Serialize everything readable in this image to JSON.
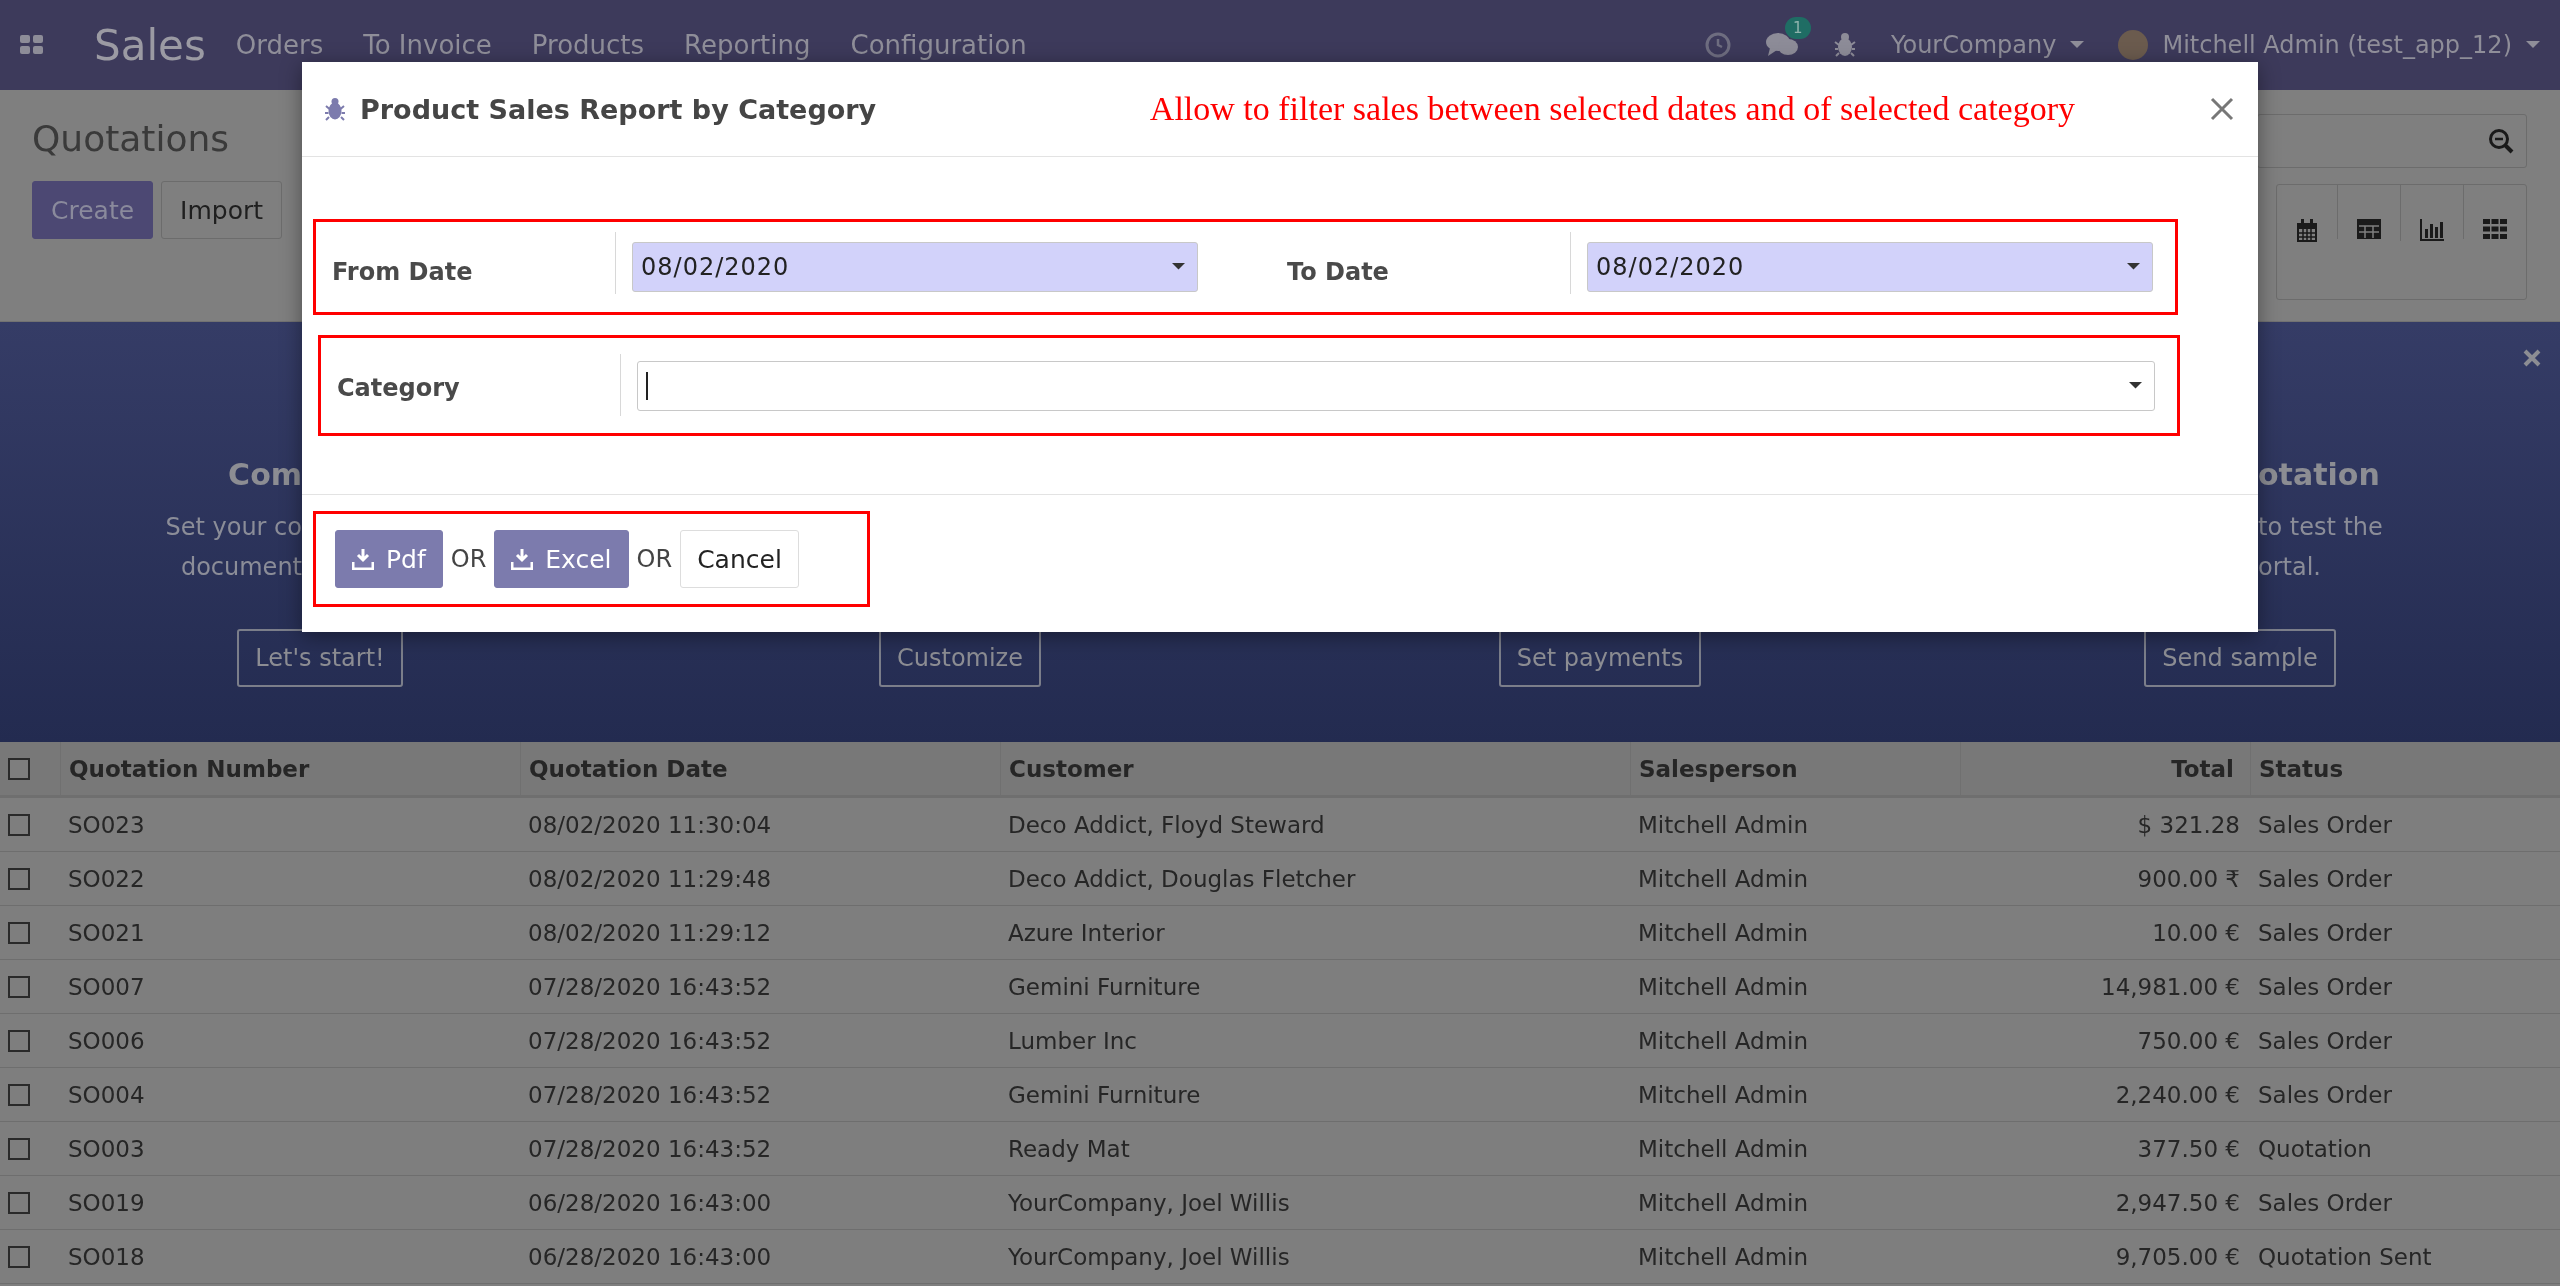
{
  "navbar": {
    "app_title": "Sales",
    "menu": [
      "Orders",
      "To Invoice",
      "Products",
      "Reporting",
      "Configuration"
    ],
    "message_count": "1",
    "company": "YourCompany",
    "user": "Mitchell Admin (test_app_12)"
  },
  "control_panel": {
    "title": "Quotations",
    "buttons": [
      {
        "label": "Create",
        "kind": "primary"
      },
      {
        "label": "Import",
        "kind": "secondary"
      }
    ]
  },
  "banner": {
    "left": {
      "heading": "Com",
      "lines": [
        "Set your co",
        "document"
      ]
    },
    "right": {
      "heading": "otation",
      "lines": [
        "to test the",
        "ortal."
      ]
    },
    "buttons": [
      "Let's start!",
      "Customize",
      "Set payments",
      "Send sample"
    ]
  },
  "dialog": {
    "title": "Product Sales Report by Category",
    "annotation": "Allow to filter sales between selected dates and of selected category",
    "date_fields": [
      {
        "label": "From Date",
        "value": "08/02/2020",
        "required": true
      },
      {
        "label": "To Date",
        "value": "08/02/2020",
        "required": true
      }
    ],
    "category_field": {
      "label": "Category",
      "required": false
    },
    "footer": [
      {
        "kind": "primary",
        "label": "Pdf"
      },
      {
        "kind": "text",
        "label": "OR"
      },
      {
        "kind": "primary",
        "label": "Excel"
      },
      {
        "kind": "text",
        "label": "OR"
      },
      {
        "kind": "secondary",
        "label": "Cancel"
      }
    ]
  },
  "table": {
    "all_checked": false,
    "columns": [
      "Quotation Number",
      "Quotation Date",
      "Customer",
      "Salesperson",
      "Total",
      "Status"
    ],
    "rows": [
      {
        "checked": false,
        "cells": [
          "SO023",
          "08/02/2020 11:30:04",
          "Deco Addict, Floyd Steward",
          "Mitchell Admin",
          "$ 321.28",
          "Sales Order"
        ]
      },
      {
        "checked": false,
        "cells": [
          "SO022",
          "08/02/2020 11:29:48",
          "Deco Addict, Douglas Fletcher",
          "Mitchell Admin",
          "900.00 ₹",
          "Sales Order"
        ]
      },
      {
        "checked": false,
        "cells": [
          "SO021",
          "08/02/2020 11:29:12",
          "Azure Interior",
          "Mitchell Admin",
          "10.00 €",
          "Sales Order"
        ]
      },
      {
        "checked": false,
        "cells": [
          "SO007",
          "07/28/2020 16:43:52",
          "Gemini Furniture",
          "Mitchell Admin",
          "14,981.00 €",
          "Sales Order"
        ]
      },
      {
        "checked": false,
        "cells": [
          "SO006",
          "07/28/2020 16:43:52",
          "Lumber Inc",
          "Mitchell Admin",
          "750.00 €",
          "Sales Order"
        ]
      },
      {
        "checked": false,
        "cells": [
          "SO004",
          "07/28/2020 16:43:52",
          "Gemini Furniture",
          "Mitchell Admin",
          "2,240.00 €",
          "Sales Order"
        ]
      },
      {
        "checked": false,
        "cells": [
          "SO003",
          "07/28/2020 16:43:52",
          "Ready Mat",
          "Mitchell Admin",
          "377.50 €",
          "Quotation"
        ]
      },
      {
        "checked": false,
        "cells": [
          "SO019",
          "06/28/2020 16:43:00",
          "YourCompany, Joel Willis",
          "Mitchell Admin",
          "2,947.50 €",
          "Sales Order"
        ]
      },
      {
        "checked": false,
        "cells": [
          "SO018",
          "06/28/2020 16:43:00",
          "YourCompany, Joel Willis",
          "Mitchell Admin",
          "9,705.00 €",
          "Quotation Sent"
        ]
      }
    ]
  }
}
